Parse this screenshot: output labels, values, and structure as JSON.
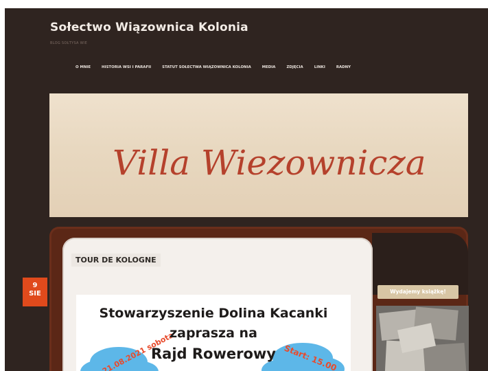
{
  "site": {
    "title": "Sołectwo Wiązownica Kolonia",
    "description": "BLOG SOŁTYSA WIE"
  },
  "nav": {
    "items": [
      {
        "label": "O MNIE"
      },
      {
        "label": "HISTORIA WSI I PARAFII"
      },
      {
        "label": "STATUT SOŁECTWA WIĄZOWNICA KOLONIA"
      },
      {
        "label": "MEDIA"
      },
      {
        "label": "ZDJĘCIA"
      },
      {
        "label": "LINKI"
      },
      {
        "label": "RADNY"
      }
    ]
  },
  "banner": {
    "text": "Villa Wiezownicza"
  },
  "post": {
    "title": "TOUR DE KOLOGNE",
    "date_day": "9",
    "date_month": "SIE",
    "poster": {
      "line1": "Stowarzyszenie Dolina Kacanki",
      "line2": "zaprasza na",
      "line3": "Rajd Rowerowy",
      "left_cloud": "21.08.2021 sobota",
      "right_cloud": "Start: 15.00"
    }
  },
  "sidebar": {
    "tag_label": "Wydajemy książkę!"
  },
  "colors": {
    "background": "#2f2420",
    "accent": "#e04a1c",
    "panel": "#5b2716",
    "cloud": "#5db7e8"
  }
}
